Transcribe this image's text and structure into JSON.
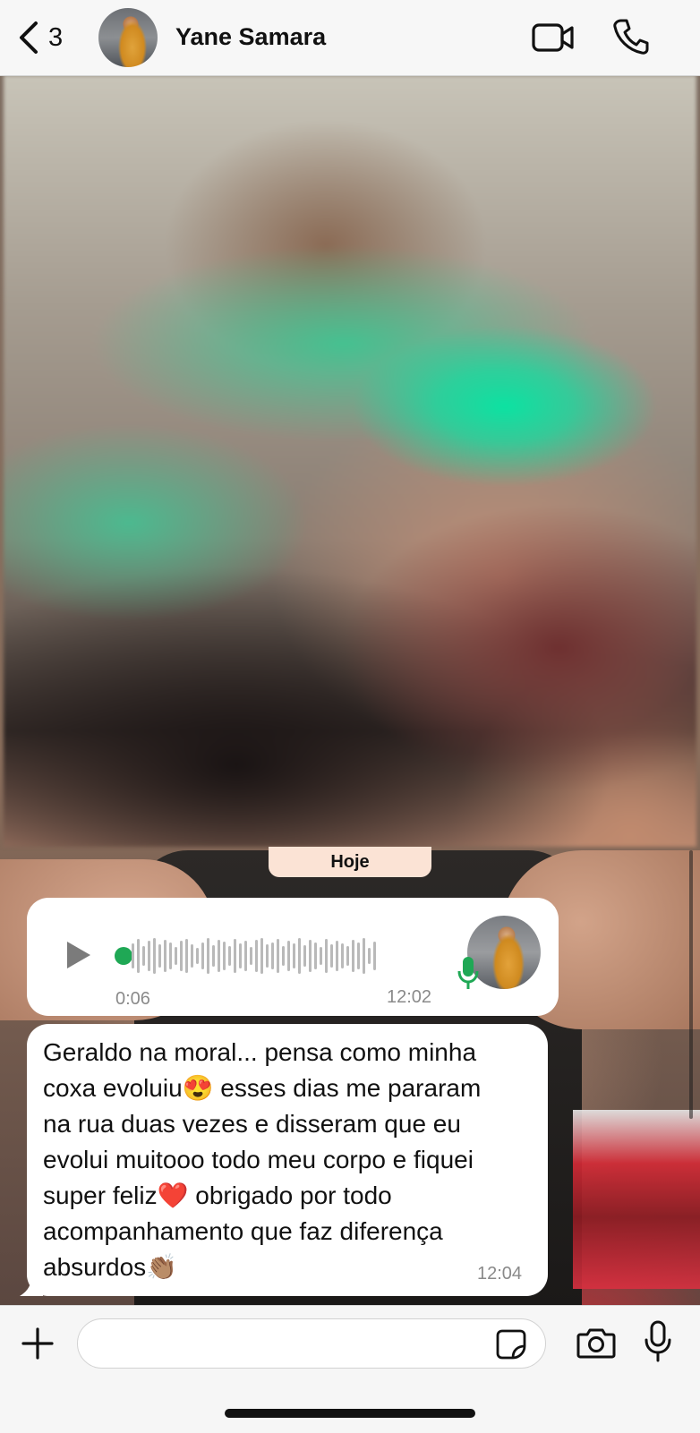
{
  "header": {
    "back_count": "3",
    "contact_name": "Yane Samara",
    "icons": {
      "back": "chevron-left-icon",
      "video": "video-camera-icon",
      "call": "phone-icon"
    }
  },
  "chat": {
    "date_separator": "Hoje",
    "voice_message": {
      "duration": "0:06",
      "time": "12:02",
      "icons": {
        "play": "play-icon",
        "mic": "microphone-icon"
      },
      "accent_color": "#1fa855"
    },
    "text_message": {
      "text": "Geraldo na moral... pensa como minha\ncoxa evoluiu😍 esses dias me pararam\nna rua duas vezes e disseram que eu\nevolui muitooo todo meu corpo e fiquei\nsuper feliz❤️ obrigado por todo\nacompanhamento que faz diferença\nabsurdos👏🏽",
      "time": "12:04"
    }
  },
  "input_bar": {
    "placeholder": "",
    "icons": {
      "add": "plus-icon",
      "sticker": "sticker-icon",
      "camera": "camera-icon",
      "mic": "microphone-icon"
    }
  },
  "colors": {
    "header_bg": "#f7f7f7",
    "bubble_bg": "#ffffff",
    "date_pill_bg": "#fbe3d5",
    "accent_green": "#1fa855"
  }
}
